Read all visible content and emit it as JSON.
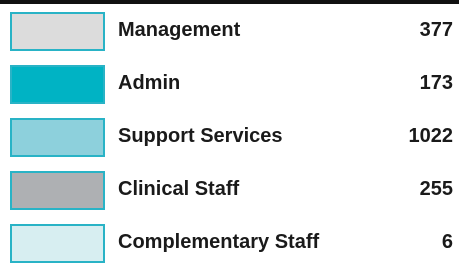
{
  "chart_data": {
    "type": "table",
    "categories": [
      "Management",
      "Admin",
      "Support Services",
      "Clinical Staff",
      "Complementary Staff"
    ],
    "values": [
      377,
      173,
      1022,
      255,
      6
    ],
    "colors": [
      "#dcdcdc",
      "#00b3c4",
      "#8dd0dc",
      "#aeb0b3",
      "#d7eef1"
    ],
    "swatch_border_color": "#29b3c6"
  }
}
